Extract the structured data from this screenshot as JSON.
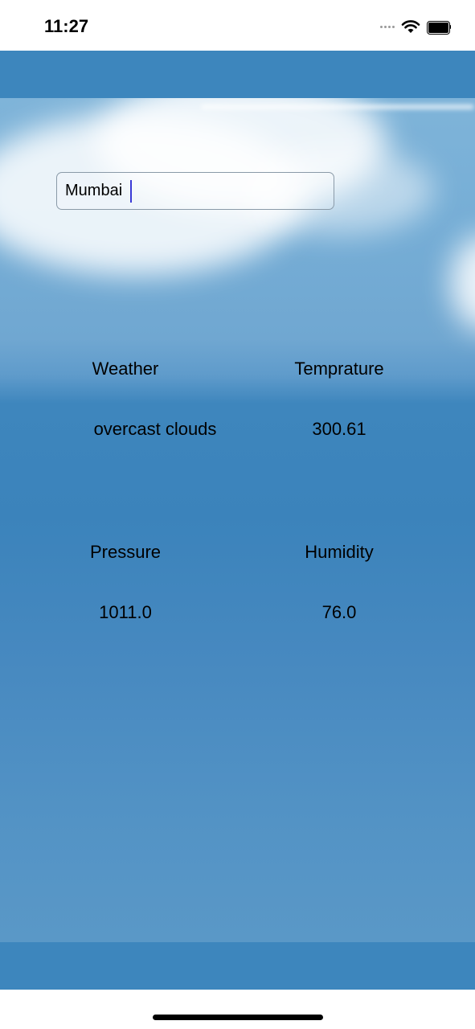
{
  "status_bar": {
    "time": "11:27"
  },
  "search": {
    "value": "Mumbai"
  },
  "weather": {
    "weather_label": "Weather",
    "weather_value": "overcast clouds",
    "temperature_label": "Temprature",
    "temperature_value": "300.61",
    "pressure_label": "Pressure",
    "pressure_value": "1011.0",
    "humidity_label": "Humidity",
    "humidity_value": "76.0"
  },
  "colors": {
    "band": "#3d86bd",
    "sky_top": "#7fb4d9",
    "sky_mid": "#3b83bb"
  }
}
